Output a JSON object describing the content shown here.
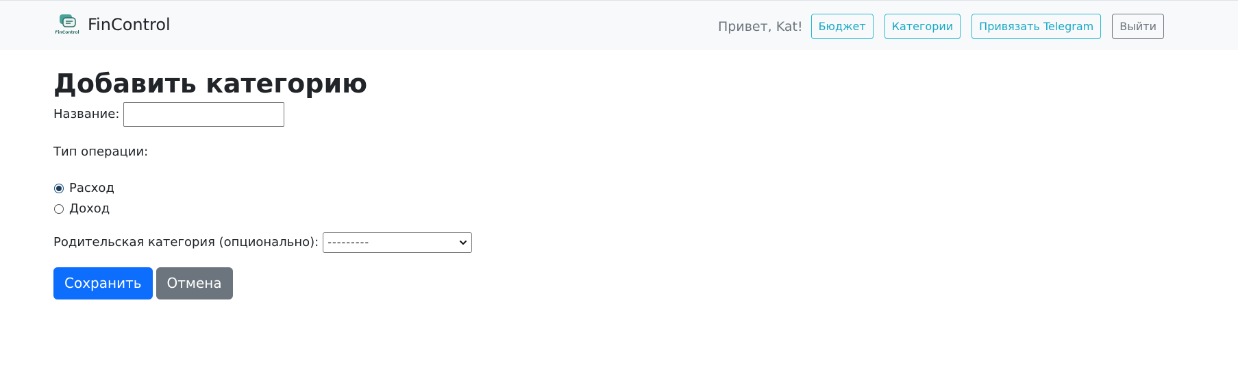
{
  "navbar": {
    "brand": "FinControl",
    "logo_text": "FinControl",
    "greeting": "Привет, Kat!",
    "links": {
      "budget": "Бюджет",
      "categories": "Категории",
      "telegram": "Привязать Telegram",
      "logout": "Выйти"
    }
  },
  "form": {
    "title": "Добавить категорию",
    "name_label": "Название:",
    "name_value": "",
    "type_label": "Тип операции:",
    "type_options": {
      "expense": "Расход",
      "income": "Доход"
    },
    "selected_type": "Расход",
    "parent_label": "Родительская категория (опционально):",
    "parent_selected": "---------",
    "save_label": "Сохранить",
    "cancel_label": "Отмена"
  },
  "colors": {
    "primary": "#0d6efd",
    "secondary": "#6c757d",
    "info": "#0dcaf0",
    "navbar_bg": "#f8f9fa"
  }
}
